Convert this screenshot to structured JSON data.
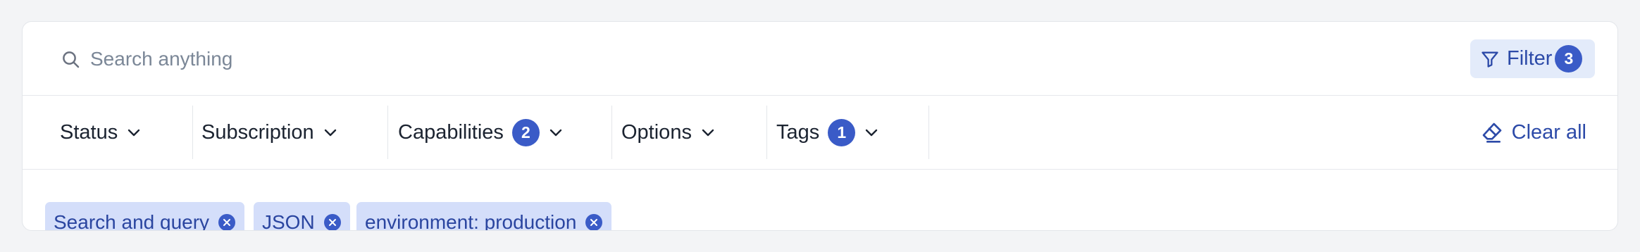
{
  "search": {
    "placeholder": "Search anything",
    "value": ""
  },
  "filter_button": {
    "label": "Filter",
    "count": "3",
    "icon": "funnel-icon"
  },
  "dropdowns": [
    {
      "label": "Status",
      "badge": null
    },
    {
      "label": "Subscription",
      "badge": null
    },
    {
      "label": "Capabilities",
      "badge": "2"
    },
    {
      "label": "Options",
      "badge": null
    },
    {
      "label": "Tags",
      "badge": "1"
    }
  ],
  "clear_all": {
    "label": "Clear all",
    "icon": "eraser-icon"
  },
  "active_filters": [
    {
      "label": "Search and query"
    },
    {
      "label": "JSON"
    },
    {
      "label": "environment: production"
    }
  ],
  "colors": {
    "accent": "#3a5bc7",
    "accent_text": "#2c4aa8",
    "chip_bg": "#d4defa",
    "filter_bg": "#e3ebfa"
  }
}
